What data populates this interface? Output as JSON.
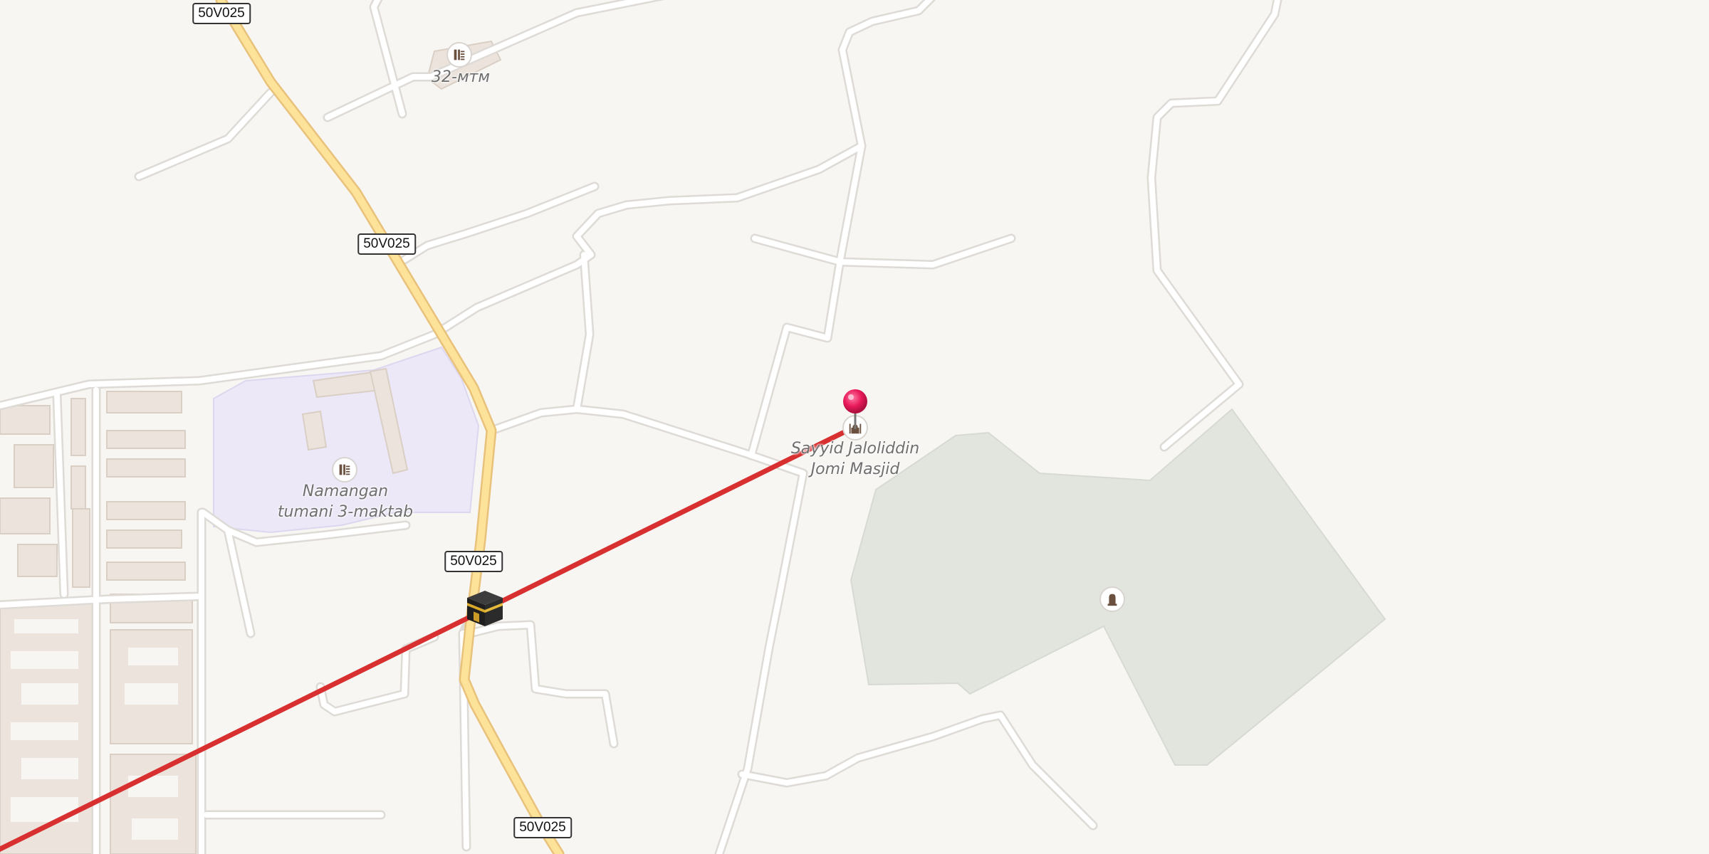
{
  "map": {
    "route_shields": [
      "50V025",
      "50V025",
      "50V025",
      "50V025"
    ],
    "labels": {
      "school_32": "32-мтм",
      "school_3_line1": "Namangan",
      "school_3_line2": "tumani 3-maktab",
      "mosque_line1": "Sayyid Jaloliddin",
      "mosque_line2": "Jomi Masjid"
    },
    "icons": {
      "school": "school-icon",
      "mosque": "mosque-icon",
      "cemetery": "cemetery-icon",
      "kaaba": "kaaba-icon",
      "pin": "location-pin-icon"
    },
    "colors": {
      "background": "#f8f6f3",
      "road": "#ffffff",
      "road_casing": "#dedad5",
      "primary_road": "#fde29a",
      "primary_road_casing": "#e8c27a",
      "school_area": "#ede8f8",
      "cemetery_area": "#e2e4de",
      "buildings": "#ece4dc",
      "qibla_line": "#d83030",
      "pin": "#e8195a"
    }
  }
}
